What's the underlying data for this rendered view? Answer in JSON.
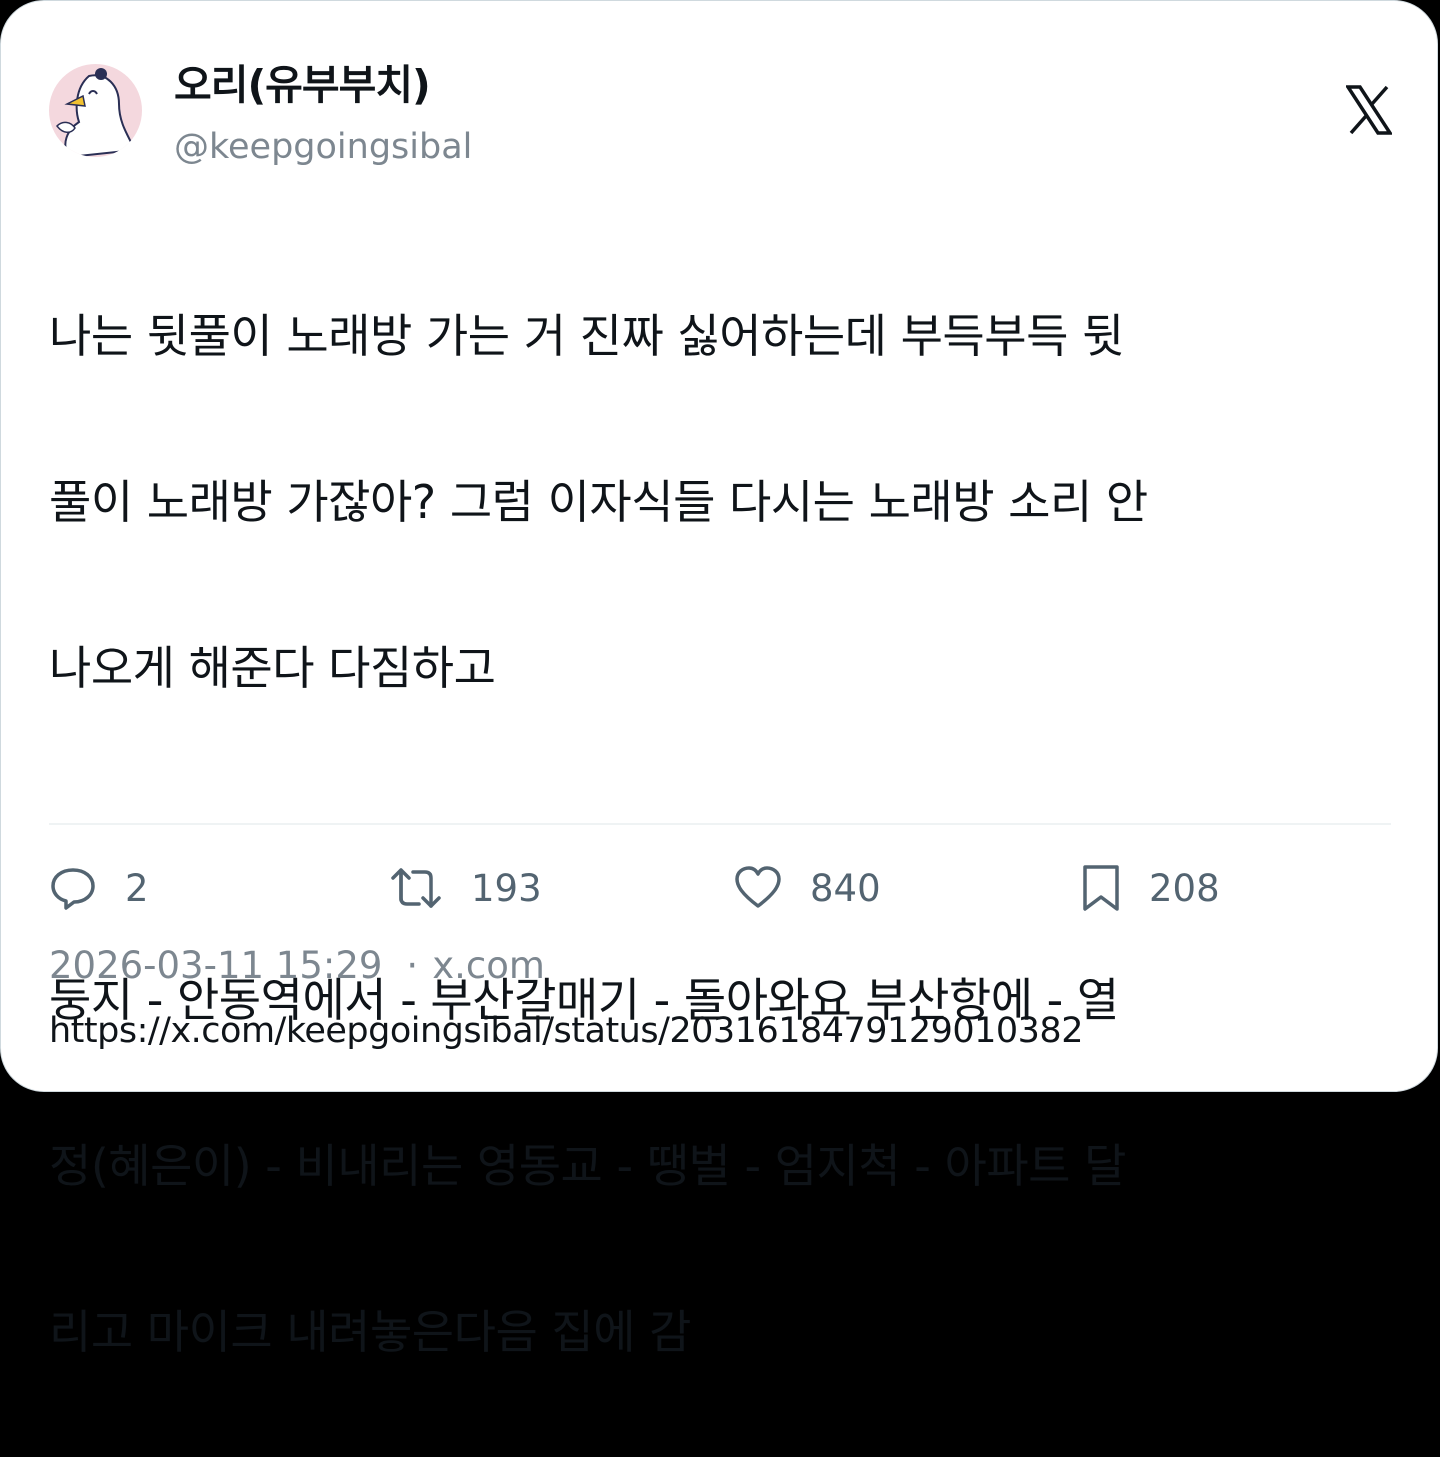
{
  "author": {
    "display_name": "오리(유부부치)",
    "handle": "@keepgoingsibal",
    "avatar_icon": "duck-avatar-icon"
  },
  "brand_icon": "x-logo-icon",
  "tweet": {
    "text_lines": [
      "나는 뒷풀이 노래방 가는 거 진짜 싫어하는데 부득부득 뒷",
      "풀이 노래방 가잖아? 그럼 이자식들 다시는 노래방 소리 안",
      "나오게 해준다 다짐하고",
      "",
      "둥지 - 안동역에서 - 부산갈매기 - 돌아와요 부산항에 - 열",
      "정(혜은이) - 비내리는 영동교 - 땡벌 - 엄지척 - 아파트 달",
      "리고 마이크 내려놓은다음 집에 감"
    ]
  },
  "metrics": {
    "replies": "2",
    "retweets": "193",
    "likes": "840",
    "bookmarks": "208"
  },
  "meta": {
    "timestamp": "2026-03-11 15:29",
    "separator": "·",
    "source": "x.com"
  },
  "url": "https://x.com/keepgoingsibal/status/2031618479129010382",
  "colors": {
    "text": "#0f1419",
    "secondary": "#536471",
    "muted": "#7d8790",
    "border": "#cfd9de",
    "avatar_bg": "#f4d8de"
  }
}
